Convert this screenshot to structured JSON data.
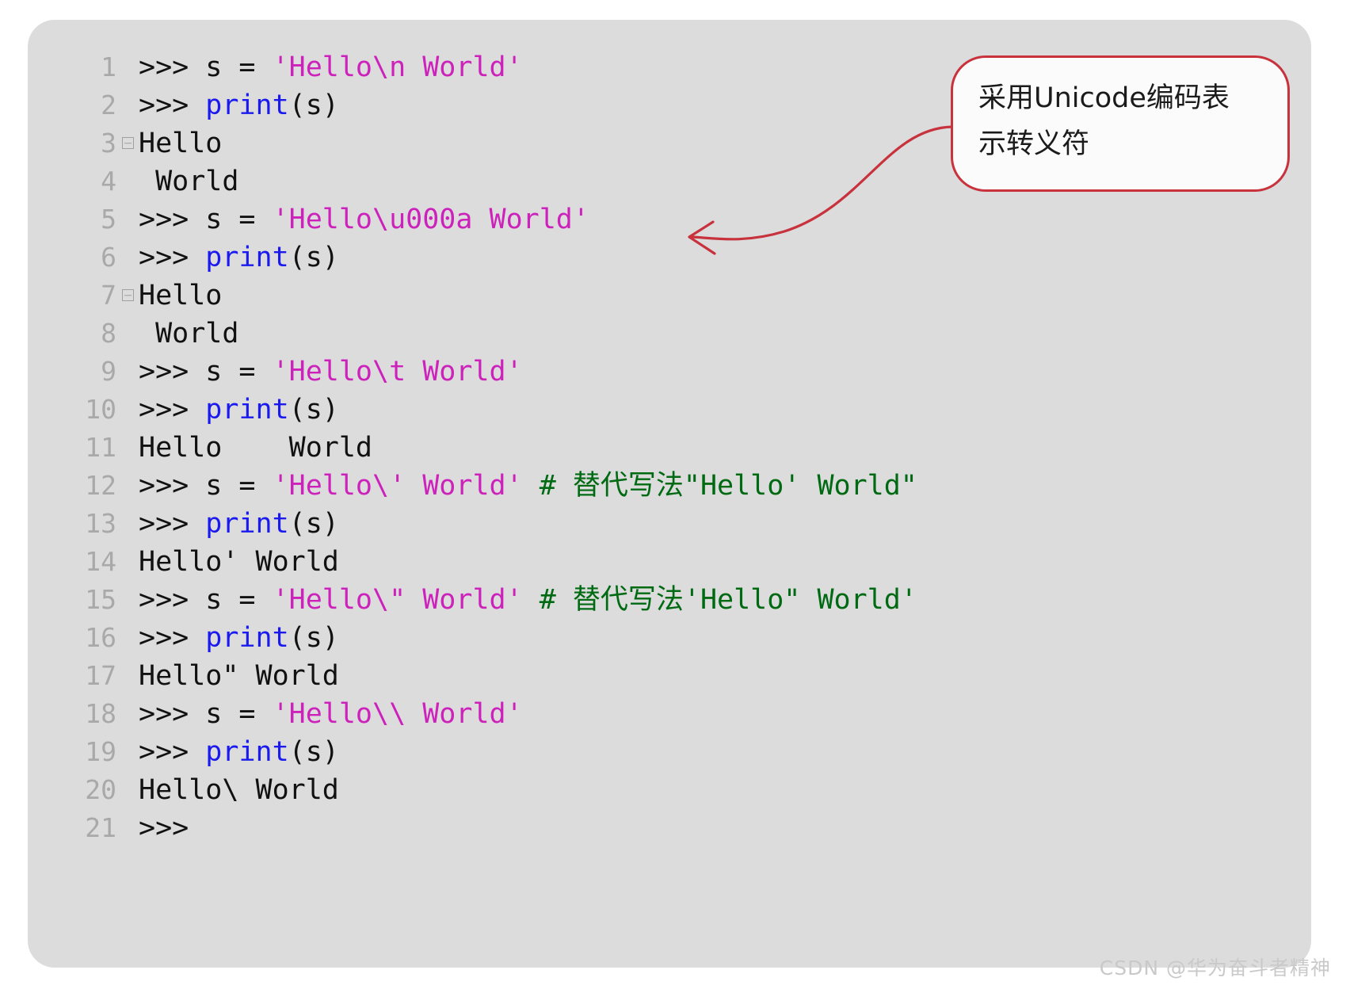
{
  "panel": {
    "background_color": "#dcdcdc",
    "page_background_color": "#ffffff"
  },
  "colors": {
    "string": "#cc22bb",
    "keyword": "#1a1aee",
    "comment": "#006a13",
    "plain": "#111111",
    "line_number": "#a9a9a9",
    "callout_border": "#c8323c",
    "callout_fill": "#fbfbfb",
    "arrow": "#c8323c",
    "watermark": "#c9c9c9"
  },
  "code": {
    "language": "python-repl",
    "lines": [
      {
        "num": "1",
        "fold": false,
        "tokens": [
          {
            "t": ">>> s = ",
            "c": "plain"
          },
          {
            "t": "'Hello\\n World'",
            "c": "str"
          }
        ]
      },
      {
        "num": "2",
        "fold": false,
        "tokens": [
          {
            "t": ">>> ",
            "c": "plain"
          },
          {
            "t": "print",
            "c": "kw"
          },
          {
            "t": "(s)",
            "c": "plain"
          }
        ]
      },
      {
        "num": "3",
        "fold": true,
        "tokens": [
          {
            "t": "Hello",
            "c": "plain"
          }
        ]
      },
      {
        "num": "4",
        "fold": false,
        "tokens": [
          {
            "t": " World",
            "c": "plain"
          }
        ]
      },
      {
        "num": "5",
        "fold": false,
        "tokens": [
          {
            "t": ">>> s = ",
            "c": "plain"
          },
          {
            "t": "'Hello\\u000a World'",
            "c": "str"
          }
        ]
      },
      {
        "num": "6",
        "fold": false,
        "tokens": [
          {
            "t": ">>> ",
            "c": "plain"
          },
          {
            "t": "print",
            "c": "kw"
          },
          {
            "t": "(s)",
            "c": "plain"
          }
        ]
      },
      {
        "num": "7",
        "fold": true,
        "tokens": [
          {
            "t": "Hello",
            "c": "plain"
          }
        ]
      },
      {
        "num": "8",
        "fold": false,
        "tokens": [
          {
            "t": " World",
            "c": "plain"
          }
        ]
      },
      {
        "num": "9",
        "fold": false,
        "tokens": [
          {
            "t": ">>> s = ",
            "c": "plain"
          },
          {
            "t": "'Hello\\t World'",
            "c": "str"
          }
        ]
      },
      {
        "num": "10",
        "fold": false,
        "tokens": [
          {
            "t": ">>> ",
            "c": "plain"
          },
          {
            "t": "print",
            "c": "kw"
          },
          {
            "t": "(s)",
            "c": "plain"
          }
        ]
      },
      {
        "num": "11",
        "fold": false,
        "tokens": [
          {
            "t": "Hello    World",
            "c": "plain"
          }
        ]
      },
      {
        "num": "12",
        "fold": false,
        "tokens": [
          {
            "t": ">>> s = ",
            "c": "plain"
          },
          {
            "t": "'Hello\\' World'",
            "c": "str"
          },
          {
            "t": " # 替代写法\"Hello' World\"",
            "c": "comment"
          }
        ]
      },
      {
        "num": "13",
        "fold": false,
        "tokens": [
          {
            "t": ">>> ",
            "c": "plain"
          },
          {
            "t": "print",
            "c": "kw"
          },
          {
            "t": "(s)",
            "c": "plain"
          }
        ]
      },
      {
        "num": "14",
        "fold": false,
        "tokens": [
          {
            "t": "Hello' World",
            "c": "plain"
          }
        ]
      },
      {
        "num": "15",
        "fold": false,
        "tokens": [
          {
            "t": ">>> s = ",
            "c": "plain"
          },
          {
            "t": "'Hello\\\" World'",
            "c": "str"
          },
          {
            "t": " # 替代写法'Hello\" World'",
            "c": "comment"
          }
        ]
      },
      {
        "num": "16",
        "fold": false,
        "tokens": [
          {
            "t": ">>> ",
            "c": "plain"
          },
          {
            "t": "print",
            "c": "kw"
          },
          {
            "t": "(s)",
            "c": "plain"
          }
        ]
      },
      {
        "num": "17",
        "fold": false,
        "tokens": [
          {
            "t": "Hello\" World",
            "c": "plain"
          }
        ]
      },
      {
        "num": "18",
        "fold": false,
        "tokens": [
          {
            "t": ">>> s = ",
            "c": "plain"
          },
          {
            "t": "'Hello\\\\ World'",
            "c": "str"
          }
        ]
      },
      {
        "num": "19",
        "fold": false,
        "tokens": [
          {
            "t": ">>> ",
            "c": "plain"
          },
          {
            "t": "print",
            "c": "kw"
          },
          {
            "t": "(s)",
            "c": "plain"
          }
        ]
      },
      {
        "num": "20",
        "fold": false,
        "tokens": [
          {
            "t": "Hello\\ World",
            "c": "plain"
          }
        ]
      },
      {
        "num": "21",
        "fold": false,
        "tokens": [
          {
            "t": ">>>",
            "c": "plain"
          }
        ]
      }
    ]
  },
  "callout": {
    "lines": [
      "采用Unicode编码表",
      "示转义符"
    ],
    "full_text": "采用Unicode编码表示转义符",
    "points_to_line": "5"
  },
  "watermark": {
    "text": "CSDN @华为奋斗者精神"
  }
}
